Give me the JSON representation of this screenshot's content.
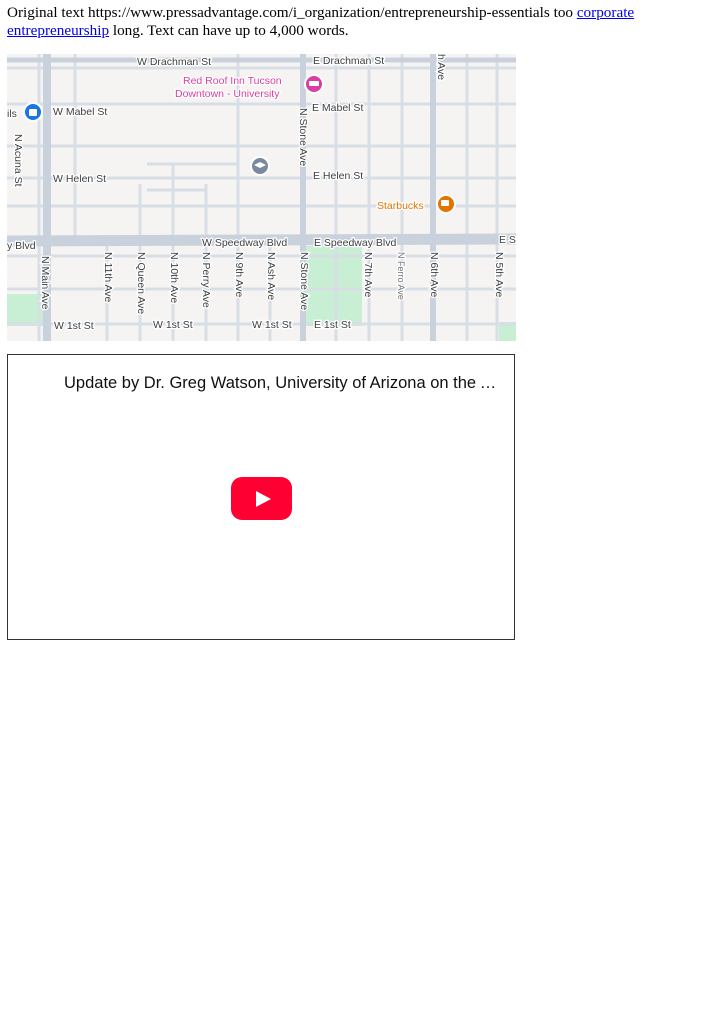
{
  "intro": {
    "text": "Original text https://www.pressadvantage.com/i_organization/entrepreneurship-essentials too ",
    "link_text": "corporate entrepreneurship",
    "text_after": " long. Text can have up to 4,000 words."
  },
  "map": {
    "streets": {
      "w_drachman": "W Drachman St",
      "e_drachman": "E Drachman St",
      "th_ave": "h Ave",
      "w_mabel": "W Mabel St",
      "e_mabel": "E Mabel St",
      "w_helen": "W Helen St",
      "e_helen": "E Helen St",
      "n_acuna": "N Acuna St",
      "n_stone_top": "N Stone Ave",
      "y_blvd": "y Blvd",
      "w_speedway": "W Speedway Blvd",
      "e_speedway": "E Speedway Blvd",
      "e_s": "E S",
      "n_main": "N Main Ave",
      "n_11th": "N 11th Ave",
      "n_queen": "N Queen Ave",
      "n_10th": "N 10th Ave",
      "n_perry": "N Perry Ave",
      "n_9th": "N 9th Ave",
      "n_ash": "N Ash Ave",
      "n_stone_bottom": "N Stone Ave",
      "n_7th": "N 7th Ave",
      "n_ferro": "N Ferro Ave",
      "n_6th": "N 6th Ave",
      "n_5th": "N 5th Ave",
      "w_1st_a": "W 1st St",
      "w_1st_b": "W 1st St",
      "w_1st_c": "W 1st St",
      "e_1st": "E 1st St"
    },
    "pois": {
      "hotel_line1": "Red Roof Inn Tucson",
      "hotel_line2": "Downtown - University",
      "cafe": "Starbucks",
      "shop_partial": "ils"
    },
    "colors": {
      "land": "#f6f4f2",
      "road": "#d8dee6",
      "major_road": "#c9d2dc",
      "park": "#c8efd4",
      "hotel_pin": "#d93fa3",
      "cafe_pin": "#e37400",
      "shop_pin": "#1a73e8"
    }
  },
  "video": {
    "title": "Update by Dr. Greg Watson, University of Arizona on the Arizona Commerce Authority",
    "play_icon": "play-icon",
    "brand_color": "#ff0033"
  }
}
